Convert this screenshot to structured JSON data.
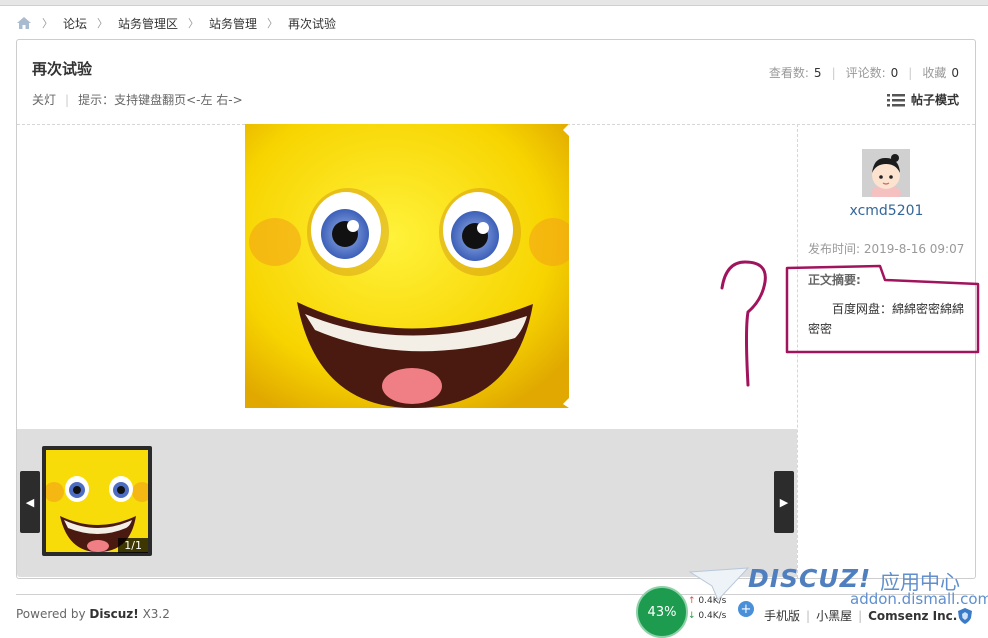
{
  "breadcrumb": [
    "论坛",
    "站务管理区",
    "站务管理",
    "再次试验"
  ],
  "thread": {
    "title": "再次试验",
    "lights_off": "关灯",
    "hint": "提示：支持键盘翻页<-左 右->",
    "views_label": "查看数:",
    "views": "5",
    "replies_label": "评论数:",
    "replies": "0",
    "favorites_label": "收藏",
    "favorites": "0",
    "mode_label": "帖子模式"
  },
  "gallery": {
    "counter": "1/1",
    "prev_glyph": "◀",
    "next_glyph": "▶"
  },
  "author": {
    "username": "xcmd5201",
    "post_time": "发布时间: 2019-8-16 09:07",
    "summary_label": "正文摘要:",
    "summary": "百度网盘：綿綿密密綿綿密密"
  },
  "footer": {
    "powered_prefix": "Powered by",
    "powered_brand": "Discuz!",
    "powered_version": "X3.2",
    "links": [
      "手机版",
      "小黑屋"
    ],
    "company": "Comsenz Inc."
  },
  "overlay": {
    "gauge": "43%",
    "up_speed": "0.4K/s",
    "down_speed": "0.4K/s",
    "up_arrow": "↑",
    "down_arrow": "↓",
    "plus": "+"
  },
  "watermark": {
    "brand": "DISCUZ!",
    "cn": "应用中心",
    "url": "addon.dismall.com"
  },
  "colors": {
    "username": "#336699",
    "annotation": "#a0135d",
    "gallery_strip": "#dedede"
  }
}
